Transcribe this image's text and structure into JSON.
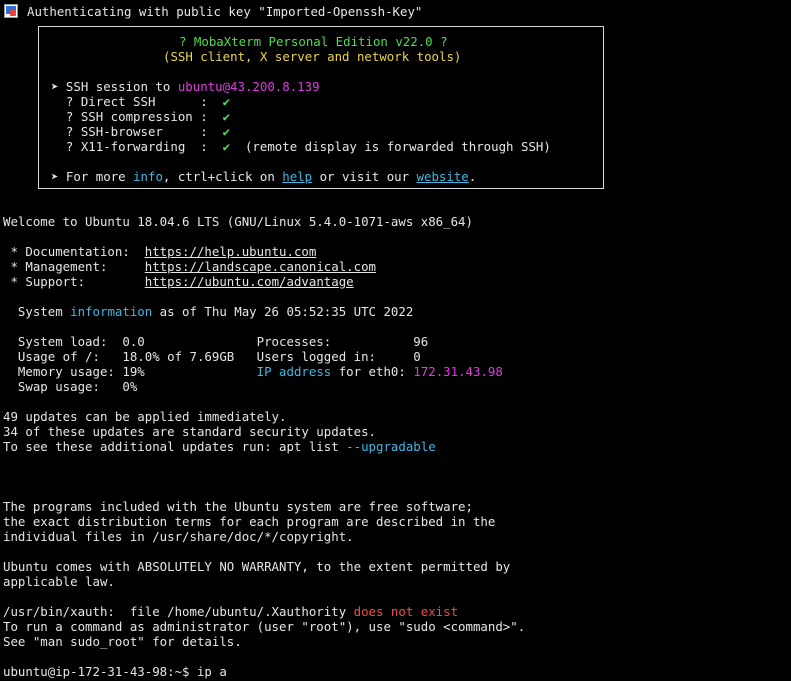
{
  "auth_line": "Authenticating with public key \"Imported-Openssh-Key\"",
  "banner": {
    "title": "? MobaXterm Personal Edition v22.0 ?",
    "subtitle": "(SSH client, X server and network tools)",
    "session_prefix": "➤ SSH session to ",
    "session_target": "ubuntu@43.200.8.139",
    "features": [
      {
        "label": "  ? Direct SSH      :  ",
        "check": "✔",
        "note": ""
      },
      {
        "label": "  ? SSH compression :  ",
        "check": "✔",
        "note": ""
      },
      {
        "label": "  ? SSH-browser     :  ",
        "check": "✔",
        "note": ""
      },
      {
        "label": "  ? X11-forwarding  :  ",
        "check": "✔",
        "note": "  (remote display is forwarded through SSH)"
      }
    ],
    "more_prefix": "➤ For more ",
    "more_info": "info",
    "more_mid": ", ctrl+click on ",
    "more_help": "help",
    "more_mid2": " or visit our ",
    "more_website": "website",
    "more_end": "."
  },
  "welcome": "Welcome to Ubuntu 18.04.6 LTS (GNU/Linux 5.4.0-1071-aws x86_64)",
  "links": [
    {
      "label": " * Documentation:  ",
      "url": "https://help.ubuntu.com"
    },
    {
      "label": " * Management:     ",
      "url": "https://landscape.canonical.com"
    },
    {
      "label": " * Support:        ",
      "url": "https://ubuntu.com/advantage"
    }
  ],
  "sysinfo": {
    "prefix": "  System ",
    "word": "information",
    "suffix": " as of Thu May 26 05:52:35 UTC 2022"
  },
  "stats": {
    "row1": "  System load:  0.0               Processes:           96",
    "row2": "  Usage of /:   18.0% of 7.69GB   Users logged in:     0",
    "row3_prefix": "  Memory usage: 19%               ",
    "row3_ip_label": "IP address",
    "row3_mid": " for eth0: ",
    "row3_ip": "172.31.43.98",
    "row4": "  Swap usage:   0%"
  },
  "updates": {
    "line1": "49 updates can be applied immediately.",
    "line2": "34 of these updates are standard security updates.",
    "line3_prefix": "To see these additional updates run: apt list ",
    "line3_flag": "--upgradable"
  },
  "legal": [
    "The programs included with the Ubuntu system are free software;",
    "the exact distribution terms for each program are described in the",
    "individual files in /usr/share/doc/*/copyright."
  ],
  "warranty": [
    "Ubuntu comes with ABSOLUTELY NO WARRANTY, to the extent permitted by",
    "applicable law."
  ],
  "xauth_prefix": "/usr/bin/xauth:  file /home/ubuntu/.Xauthority ",
  "xauth_error": "does not exist",
  "sudo_lines": [
    "To run a command as administrator (user \"root\"), use \"sudo <command>\".",
    "See \"man sudo_root\" for details."
  ],
  "prompt": "ubuntu@ip-172-31-43-98:~$ ",
  "command": "ip a",
  "colors": {
    "background": "#000000",
    "text": "#e6e6e6",
    "green": "#4fdc4f",
    "yellow": "#ecd54c",
    "magenta": "#e03ce0",
    "cyan": "#3fb8e6",
    "red": "#ef4d4d"
  }
}
